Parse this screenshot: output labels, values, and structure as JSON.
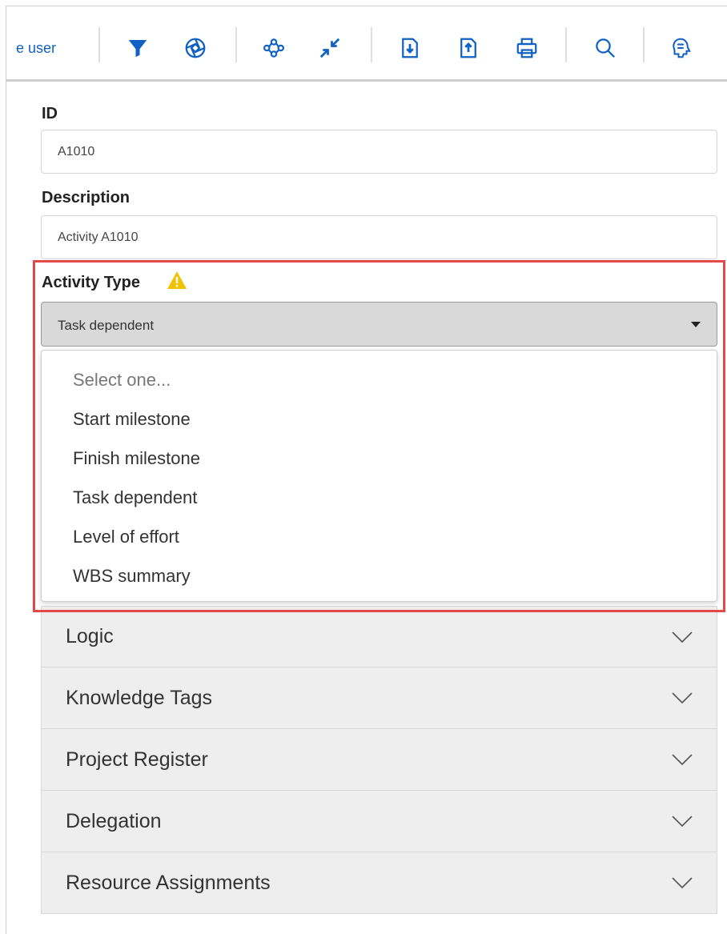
{
  "toolbar": {
    "partial_label": "e user",
    "icons": [
      "filter-icon",
      "aperture-icon",
      "network-icon",
      "collapse-icon",
      "import-icon",
      "export-icon",
      "print-icon",
      "search-icon",
      "brain-icon"
    ]
  },
  "form": {
    "id_label": "ID",
    "id_value": "A1010",
    "description_label": "Description",
    "description_value": "Activity A1010",
    "activity_type_label": "Activity Type",
    "activity_type_selected": "Task dependent"
  },
  "dropdown": {
    "options": [
      "Select one...",
      "Start milestone",
      "Finish milestone",
      "Task dependent",
      "Level of effort",
      "WBS summary"
    ]
  },
  "sections": [
    "Logic",
    "Knowledge Tags",
    "Project Register",
    "Delegation",
    "Resource Assignments"
  ],
  "colors": {
    "accent_blue": "#0f62c4",
    "highlight_red": "#e24a4a",
    "warning_yellow": "#f2c200"
  }
}
